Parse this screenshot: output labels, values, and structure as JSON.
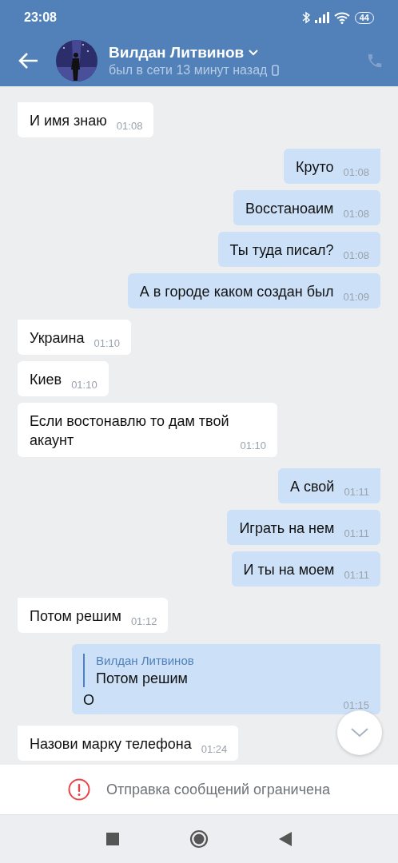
{
  "status_bar": {
    "time": "23:08",
    "battery": "44"
  },
  "header": {
    "name": "Вилдан Литвинов",
    "presence": "был в сети 13 минут назад"
  },
  "messages": [
    {
      "outgoing": false,
      "text": "И имя знаю",
      "time": "01:08"
    },
    {
      "outgoing": true,
      "text": "Круто",
      "time": "01:08"
    },
    {
      "outgoing": true,
      "text": "Восстаноаим",
      "time": "01:08"
    },
    {
      "outgoing": true,
      "text": "Ты туда писал?",
      "time": "01:08"
    },
    {
      "outgoing": true,
      "text": "А в городе каком создан был",
      "time": "01:09"
    },
    {
      "outgoing": false,
      "text": "Украина",
      "time": "01:10"
    },
    {
      "outgoing": false,
      "text": "Киев",
      "time": "01:10"
    },
    {
      "outgoing": false,
      "text": "Если востонавлю то дам твой акаунт",
      "time": "01:10"
    },
    {
      "outgoing": true,
      "text": "А свой",
      "time": "01:11"
    },
    {
      "outgoing": true,
      "text": "Играть на нем",
      "time": "01:11"
    },
    {
      "outgoing": true,
      "text": "И ты на моем",
      "time": "01:11"
    },
    {
      "outgoing": false,
      "text": "Потом решим",
      "time": "01:12"
    },
    {
      "outgoing": true,
      "text": "О",
      "time": "01:15",
      "reply": {
        "author": "Вилдан Литвинов",
        "text": "Потом решим"
      }
    },
    {
      "outgoing": false,
      "text": "Назови марку телефона",
      "time": "01:24"
    }
  ],
  "notice": "Отправка сообщений ограничена"
}
